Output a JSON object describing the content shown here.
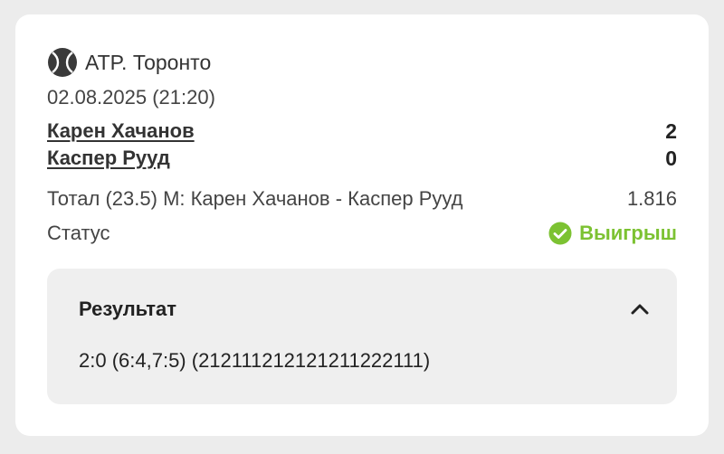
{
  "event": {
    "league": "ATP. Торонто",
    "league_icon": "tennis-ball-icon",
    "date": "02.08.2025 (21:20)"
  },
  "players": [
    {
      "name": "Карен Хачанов",
      "score": "2"
    },
    {
      "name": "Каспер Рууд",
      "score": "0"
    }
  ],
  "bet": {
    "label": "Тотал (23.5) М: Карен Хачанов - Каспер Рууд",
    "odds": "1.816"
  },
  "status": {
    "label": "Статус",
    "value": "Выигрыш",
    "icon": "check-circle-icon",
    "color": "#7cc232"
  },
  "result": {
    "title": "Результат",
    "text": "2:0 (6:4,7:5) (212111212121211222111)",
    "toggle_icon": "chevron-up-icon"
  }
}
